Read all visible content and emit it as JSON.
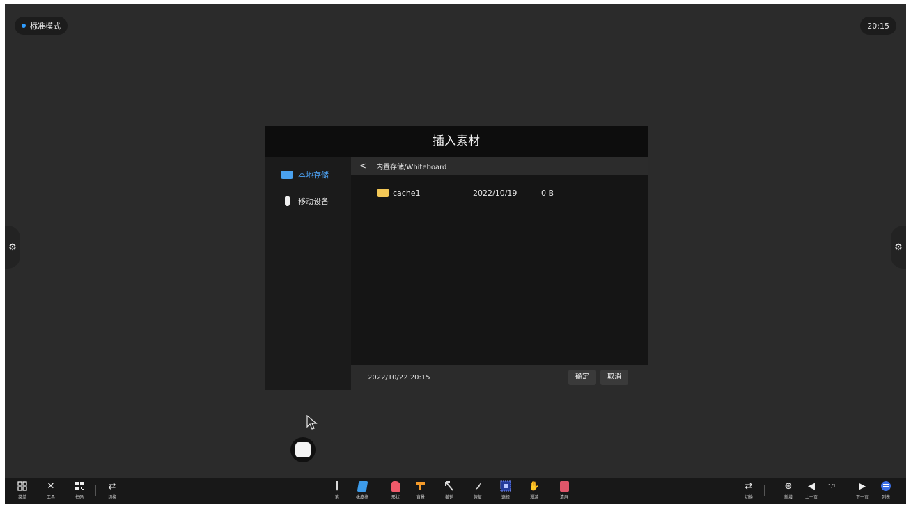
{
  "status": {
    "mode_label": "标准模式",
    "clock": "20:15"
  },
  "dialog": {
    "title": "插入素材",
    "sidebar": [
      {
        "label": "本地存储",
        "icon": "drive-icon",
        "active": true
      },
      {
        "label": "移动设备",
        "icon": "usb-icon",
        "active": false
      }
    ],
    "path": "内置存储/Whiteboard",
    "files": [
      {
        "name": "cache1",
        "date": "2022/10/19",
        "size": "0 B",
        "icon": "folder-icon"
      }
    ],
    "footer_time": "2022/10/22 20:15",
    "confirm_label": "确定",
    "cancel_label": "取消"
  },
  "toolbar": {
    "left": [
      {
        "label": "菜单",
        "icon": "grid-icon"
      },
      {
        "label": "工具",
        "icon": "tools-icon"
      },
      {
        "label": "扫码",
        "icon": "qrcode-icon"
      },
      {
        "label": "切换",
        "icon": "switch-icon"
      }
    ],
    "center": [
      {
        "label": "笔",
        "icon": "pen-icon",
        "color": "#d9d9d9"
      },
      {
        "label": "橡皮擦",
        "icon": "eraser-icon",
        "color": "#3d9be9"
      },
      {
        "label": "形状",
        "icon": "shape-icon",
        "color": "#f05a6a"
      },
      {
        "label": "背景",
        "icon": "background-icon",
        "color": "#f39a2a"
      },
      {
        "label": "撤销",
        "icon": "undo-icon",
        "color": "#d9d9d9"
      },
      {
        "label": "恢复",
        "icon": "redo-icon",
        "color": "#d9d9d9"
      },
      {
        "label": "选择",
        "icon": "select-icon",
        "color": "#4a6cf0"
      },
      {
        "label": "漫游",
        "icon": "hand-icon",
        "color": "#e6e6e6"
      },
      {
        "label": "清屏",
        "icon": "clear-icon",
        "color": "#e0566a"
      }
    ],
    "right": [
      {
        "label": "切换",
        "icon": "switch-icon"
      },
      {
        "label": "新增",
        "icon": "add-page-icon"
      },
      {
        "label": "上一页",
        "icon": "prev-page-icon"
      },
      {
        "label": "下一页",
        "icon": "next-page-icon"
      },
      {
        "label": "列表",
        "icon": "list-icon"
      }
    ],
    "page_indicator": "1/1"
  }
}
